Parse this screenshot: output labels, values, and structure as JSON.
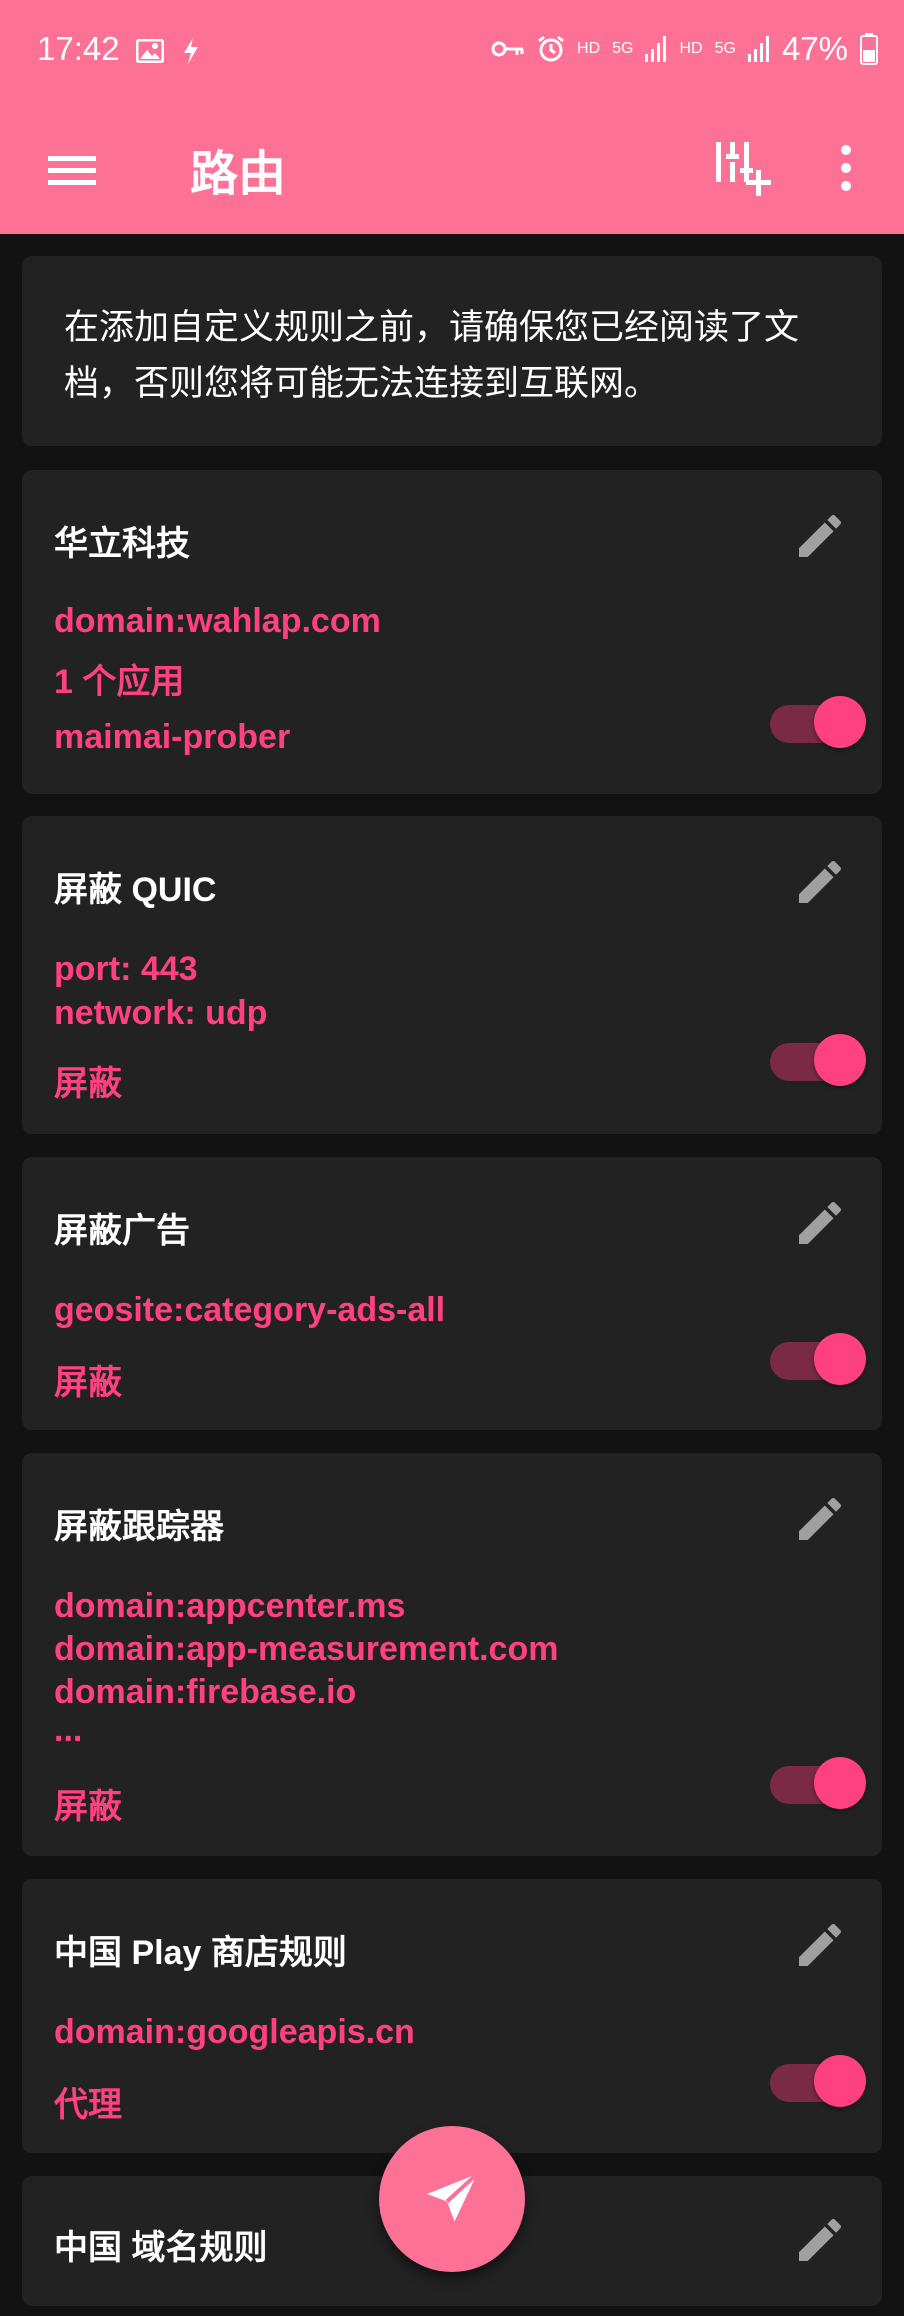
{
  "status": {
    "time": "17:42",
    "battery": "47%",
    "hd1": "HD",
    "net1": "5G",
    "hd2": "HD",
    "net2": "5G"
  },
  "appbar": {
    "title": "路由"
  },
  "notice": {
    "text": "在添加自定义规则之前，请确保您已经阅读了文档，否则您将可能无法连接到互联网。"
  },
  "rules": [
    {
      "title": "华立科技",
      "lines": [
        "domain:wahlap.com",
        "1 个应用",
        "maimai-prober"
      ],
      "enabled": true
    },
    {
      "title": "屏蔽 QUIC",
      "lines": [
        "port: 443",
        "network: udp",
        "屏蔽"
      ],
      "enabled": true
    },
    {
      "title": "屏蔽广告",
      "lines": [
        "geosite:category-ads-all",
        "屏蔽"
      ],
      "enabled": true
    },
    {
      "title": "屏蔽跟踪器",
      "lines": [
        "domain:appcenter.ms",
        "domain:app-measurement.com",
        "domain:firebase.io",
        "...",
        "屏蔽"
      ],
      "enabled": true
    },
    {
      "title": "中国 Play 商店规则",
      "lines": [
        "domain:googleapis.cn",
        "代理"
      ],
      "enabled": true
    },
    {
      "title": "中国 域名规则",
      "lines": []
    }
  ],
  "colors": {
    "primary": "#fe7196",
    "accent": "#ff4081",
    "card": "#222222",
    "background": "#121212"
  },
  "icons": {
    "menu": "hamburger-menu-icon",
    "add_rule": "add-rule-icon",
    "more": "more-vert-icon",
    "edit": "pencil-icon",
    "fab": "paper-plane-icon"
  }
}
